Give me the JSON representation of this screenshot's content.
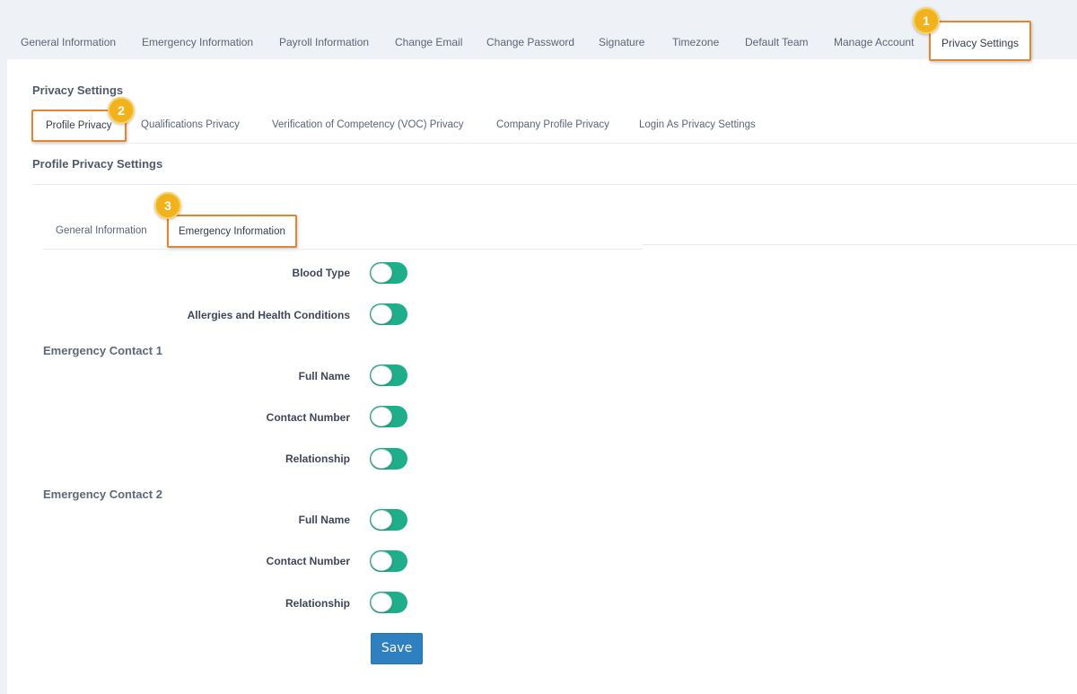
{
  "top_tabs": [
    {
      "label": "General Information"
    },
    {
      "label": "Emergency Information"
    },
    {
      "label": "Payroll Information"
    },
    {
      "label": "Change Email"
    },
    {
      "label": "Change Password"
    },
    {
      "label": "Signature"
    },
    {
      "label": "Timezone"
    },
    {
      "label": "Default Team"
    },
    {
      "label": "Manage Account"
    },
    {
      "label": "Privacy Settings",
      "active": true
    }
  ],
  "page_title": "Privacy Settings",
  "sub_tabs": [
    {
      "label": "Profile Privacy",
      "active": true
    },
    {
      "label": "Qualifications Privacy"
    },
    {
      "label": "Verification of Competency (VOC) Privacy"
    },
    {
      "label": "Company Profile Privacy"
    },
    {
      "label": "Login As Privacy Settings"
    }
  ],
  "section_title": "Profile Privacy Settings",
  "inner_tabs": [
    {
      "label": "General Information"
    },
    {
      "label": "Emergency Information",
      "active": true
    }
  ],
  "badges": [
    "1",
    "2",
    "3"
  ],
  "fields": {
    "blood_type": {
      "label": "Blood Type",
      "on": true
    },
    "allergies": {
      "label": "Allergies and Health Conditions",
      "on": true
    }
  },
  "contact1": {
    "title": "Emergency Contact 1",
    "full_name": {
      "label": "Full Name",
      "on": true
    },
    "contact_number": {
      "label": "Contact Number",
      "on": true
    },
    "relationship": {
      "label": "Relationship",
      "on": true
    }
  },
  "contact2": {
    "title": "Emergency Contact 2",
    "full_name": {
      "label": "Full Name",
      "on": true
    },
    "contact_number": {
      "label": "Contact Number",
      "on": true
    },
    "relationship": {
      "label": "Relationship",
      "on": true
    }
  },
  "save_label": "Save",
  "colors": {
    "toggle_on": "#1fae8a",
    "highlight_border": "#e3872e",
    "badge": "#f2b21b",
    "save_button": "#2f80c0"
  }
}
